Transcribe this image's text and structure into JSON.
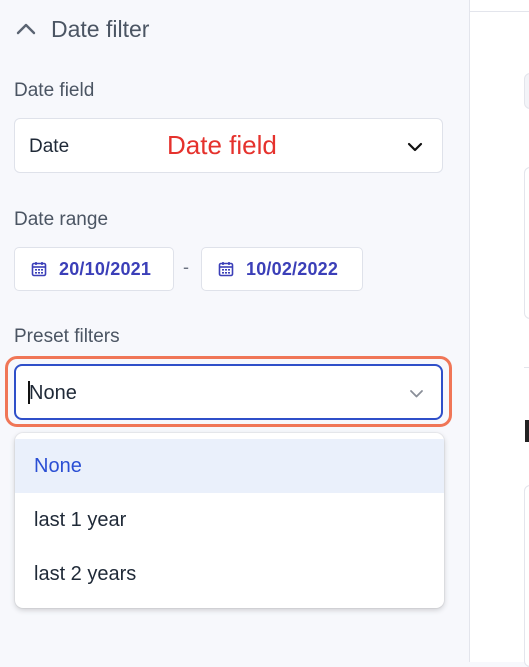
{
  "section": {
    "title": "Date filter",
    "expanded": true
  },
  "date_field": {
    "label": "Date field",
    "value": "Date",
    "annotation": "Date field"
  },
  "date_range": {
    "label": "Date range",
    "start": "20/10/2021",
    "separator": "-",
    "end": "10/02/2022"
  },
  "preset_filters": {
    "label": "Preset filters",
    "value": "None",
    "options": [
      {
        "label": "None",
        "selected": true
      },
      {
        "label": "last 1 year",
        "selected": false
      },
      {
        "label": "last 2 years",
        "selected": false
      }
    ]
  },
  "icons": {
    "section_toggle": "chevron-up-icon",
    "select_toggle": "chevron-down-icon",
    "date": "calendar-icon"
  },
  "colors": {
    "accent": "#2f4fc9",
    "date_text": "#3b3fb8",
    "annotation_red": "#e5322d",
    "highlight_ring": "#f07657",
    "selected_option_bg": "#eaf0fb"
  }
}
